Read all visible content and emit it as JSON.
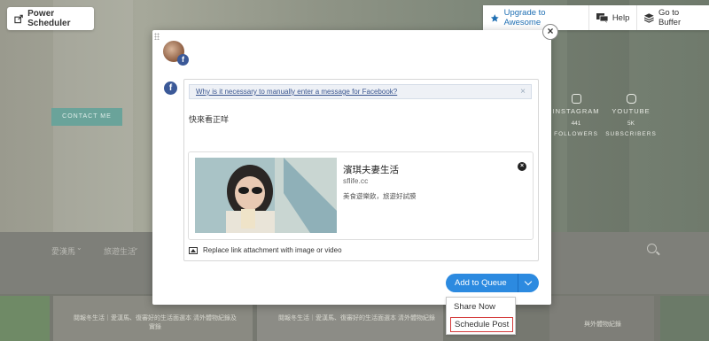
{
  "top_left": {
    "label": "Power Scheduler",
    "icon": "share-calendar-icon"
  },
  "top_bar": [
    {
      "label": "Upgrade to Awesome",
      "icon": "star-icon"
    },
    {
      "label": "Help",
      "icon": "chat-bubble-icon"
    },
    {
      "label": "Go to Buffer",
      "icon": "layers-icon"
    }
  ],
  "background": {
    "contact_button": "CONTACT ME",
    "socials": [
      {
        "name": "INSTAGRAM",
        "count": "441",
        "label": "FOLLOWERS"
      },
      {
        "name": "YOUTUBE",
        "count": "5K",
        "label": "SUBSCRIBERS"
      }
    ],
    "nav": [
      "愛漢馬",
      "旅遊生活"
    ],
    "thumb_captions": [
      "閱報冬生活｜愛漢馬、復審好的生活面選本 清外體物紀錄及實錄",
      "閱報冬生活｜愛漢馬、復審好的生活面選本 清外體物紀錄",
      "與外體物紀錄"
    ]
  },
  "modal": {
    "close": "×",
    "network_badge": "f",
    "notice_text": "Why is it necessary to manually enter a message for Facebook?",
    "notice_close": "×",
    "message": "快來看正咩",
    "link": {
      "title": "濱琪夫妻生活",
      "domain": "sflife.cc",
      "description": "美食遊樂飲，旅遊好試膜",
      "remove": "×"
    },
    "replace_label": "Replace link attachment with image or video",
    "queue_button": "Add to Queue",
    "dropdown": [
      "Share Now",
      "Schedule Post"
    ]
  },
  "colors": {
    "accent": "#2c8ae0",
    "facebook": "#3b5998",
    "highlight": "#d43a3a"
  }
}
